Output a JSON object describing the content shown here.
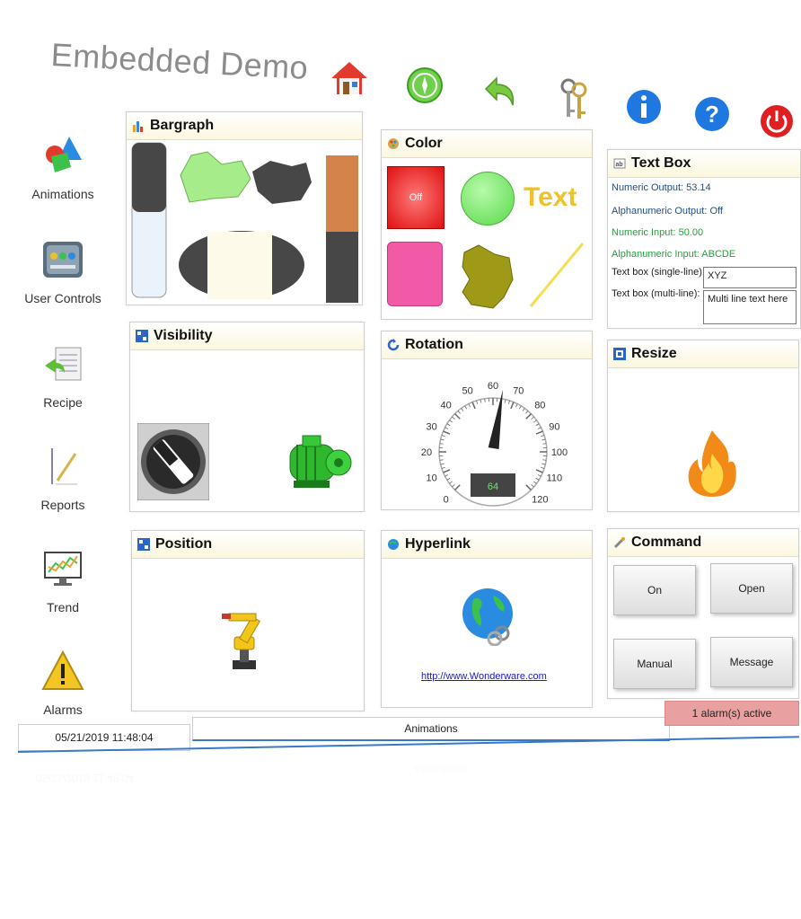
{
  "app": {
    "title": "Embedded Demo"
  },
  "toolbar": [
    {
      "name": "home-button",
      "icon": "home-icon"
    },
    {
      "name": "navigate-button",
      "icon": "compass-icon"
    },
    {
      "name": "back-button",
      "icon": "back-arrow-icon"
    },
    {
      "name": "login-button",
      "icon": "keys-icon"
    },
    {
      "name": "info-button",
      "icon": "info-icon"
    },
    {
      "name": "help-button",
      "icon": "help-icon"
    },
    {
      "name": "power-button",
      "icon": "power-icon"
    }
  ],
  "sidebar": {
    "items": [
      {
        "label": "Animations",
        "icon": "shapes-icon"
      },
      {
        "label": "User Controls",
        "icon": "controls-icon"
      },
      {
        "label": "Recipe",
        "icon": "recipe-icon"
      },
      {
        "label": "Reports",
        "icon": "reports-icon"
      },
      {
        "label": "Trend",
        "icon": "trend-icon"
      },
      {
        "label": "Alarms",
        "icon": "warning-icon"
      }
    ]
  },
  "panels": {
    "bargraph": {
      "title": "Bargraph",
      "left_bar_fill": 0.55,
      "right_bar_fill": 0.48
    },
    "color": {
      "title": "Color",
      "button_label": "Off",
      "text_sample": "Text"
    },
    "textbox": {
      "title": "Text Box",
      "numeric_output": "Numeric Output: 53.14",
      "alphanumeric_output": "Alphanumeric Output: Off",
      "numeric_input": "Numeric Input: 50.00",
      "alphanumeric_input": "Alphanumeric Input: ABCDE",
      "single_label": "Text box (single-line):",
      "single_value": "XYZ",
      "multi_label": "Text box (multi-line):",
      "multi_value": "Multi line text here"
    },
    "visibility": {
      "title": "Visibility"
    },
    "rotation": {
      "title": "Rotation",
      "ticks": [
        "0",
        "10",
        "20",
        "30",
        "40",
        "50",
        "60",
        "70",
        "80",
        "90",
        "100",
        "110",
        "120"
      ],
      "value": "64"
    },
    "resize": {
      "title": "Resize"
    },
    "position": {
      "title": "Position"
    },
    "hyperlink": {
      "title": "Hyperlink",
      "url": "http://www.Wonderware.com"
    },
    "command": {
      "title": "Command",
      "buttons": [
        "On",
        "Open",
        "Manual",
        "Message"
      ]
    }
  },
  "status": {
    "datetime": "05/21/2019 11:48:04",
    "page": "Animations",
    "alarms": "1 alarm(s) active"
  },
  "colors": {
    "accent_header": "#fbf7de",
    "alarm_bg": "#e8a0a0",
    "status_line": "#3a78c8"
  }
}
